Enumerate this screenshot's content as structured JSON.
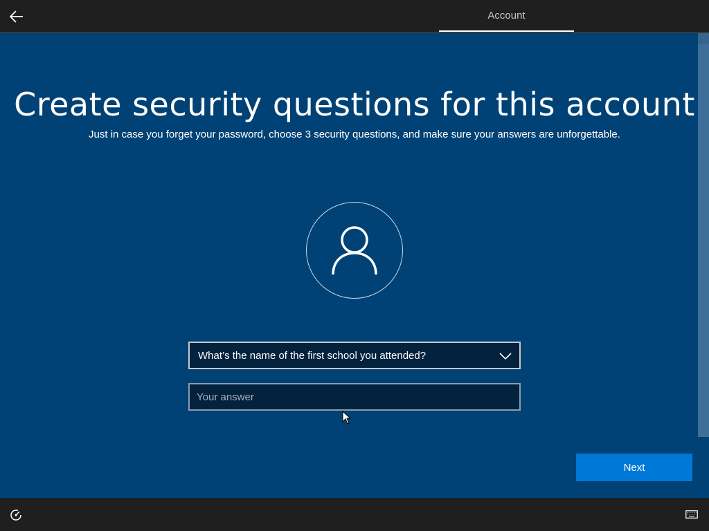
{
  "header": {
    "back_icon": "arrow-left-icon",
    "tab_label": "Account"
  },
  "main": {
    "title": "Create security questions for this account",
    "subtitle": "Just in case you forget your password, choose 3 security questions, and make sure your answers are unforgettable.",
    "avatar_icon": "user-icon",
    "question_select": {
      "selected": "What’s the name of the first school you attended?",
      "icon": "chevron-down-icon"
    },
    "answer_field": {
      "value": "",
      "placeholder": "Your answer"
    },
    "next_label": "Next"
  },
  "footer": {
    "ease_of_access_icon": "ease-of-access-icon",
    "keyboard_icon": "keyboard-icon"
  },
  "colors": {
    "background": "#004275",
    "topbar": "#1f1f1f",
    "accent": "#0078d7",
    "field_bg": "#03223e"
  }
}
